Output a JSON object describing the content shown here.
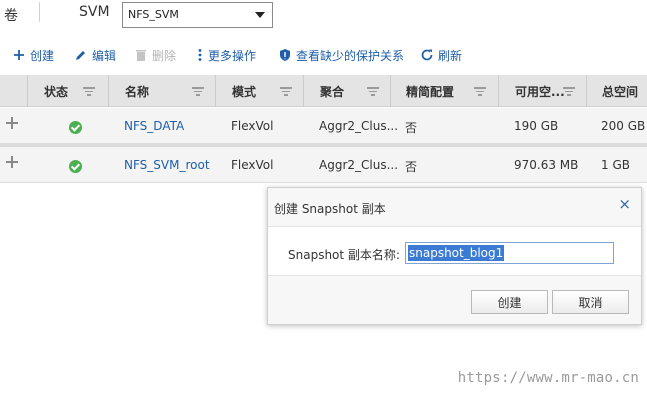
{
  "topbar": {
    "volume_label": "卷",
    "svm_label": "SVM",
    "svm_selected": "NFS_SVM"
  },
  "toolbar": {
    "create": "创建",
    "edit": "编辑",
    "delete": "删除",
    "more": "更多操作",
    "protection": "查看缺少的保护关系",
    "refresh": "刷新"
  },
  "table": {
    "columns": [
      "状态",
      "名称",
      "模式",
      "聚合",
      "精简配置",
      "可用空...",
      "总空间"
    ],
    "rows": [
      {
        "name": "NFS_DATA",
        "mode": "FlexVol",
        "aggregate": "Aggr2_Clus...",
        "thin": "否",
        "available": "190 GB",
        "total": "200 GB"
      },
      {
        "name": "NFS_SVM_root",
        "mode": "FlexVol",
        "aggregate": "Aggr2_Clus...",
        "thin": "否",
        "available": "970.63 MB",
        "total": "1 GB"
      }
    ]
  },
  "dialog": {
    "title": "创建 Snapshot 副本",
    "close": "×",
    "field_label": "Snapshot 副本名称:",
    "field_value": "snapshot_blog1",
    "ok": "创建",
    "cancel": "取消"
  },
  "watermark": "https://www.mr-mao.cn",
  "colors": {
    "link": "#1f5fa8",
    "status_ok": "#4caf50",
    "header_bg": "#e4e4e4",
    "selection": "#3c7bd4"
  }
}
